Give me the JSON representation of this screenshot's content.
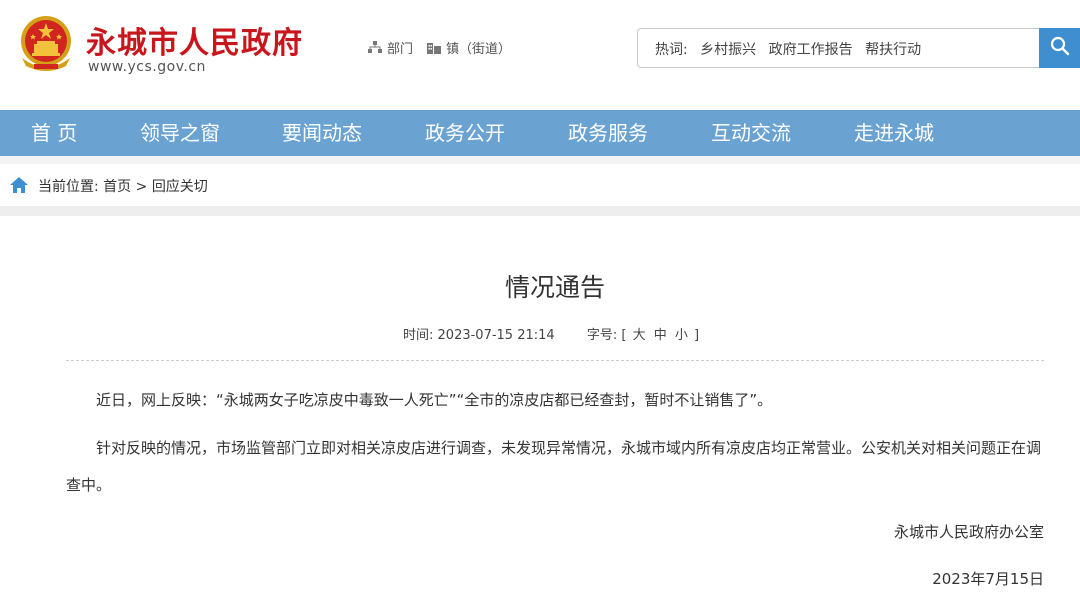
{
  "site": {
    "title": "永城市人民政府",
    "domain": "www.ycs.gov.cn"
  },
  "quick_links": [
    {
      "label": "部门",
      "icon": "org-chart-icon"
    },
    {
      "label": "镇（街道）",
      "icon": "building-icon"
    }
  ],
  "search": {
    "hot_label": "热词:",
    "hot_words": [
      "乡村振兴",
      "政府工作报告",
      "帮扶行动"
    ],
    "button_icon": "search-icon"
  },
  "nav": {
    "items": [
      "首 页",
      "领导之窗",
      "要闻动态",
      "政务公开",
      "政务服务",
      "互动交流",
      "走进永城"
    ]
  },
  "breadcrumb": {
    "prefix": "当前位置:",
    "home": "首页",
    "separator": ">",
    "current": "回应关切"
  },
  "article": {
    "title": "情况通告",
    "time_label": "时间:",
    "time_value": "2023-07-15 21:14",
    "size_label": "字号:",
    "size_open": "[",
    "size_large": "大",
    "size_medium": "中",
    "size_small": "小",
    "size_close": "]",
    "paragraphs": [
      "近日，网上反映：“永城两女子吃凉皮中毒致一人死亡”“全市的凉皮店都已经查封，暂时不让销售了”。",
      "针对反映的情况，市场监管部门立即对相关凉皮店进行调查，未发现异常情况，永城市域内所有凉皮店均正常营业。公安机关对相关问题正在调查中。"
    ],
    "signature": "永城市人民政府办公室",
    "date": "2023年7月15日"
  },
  "colors": {
    "brand_red": "#c8161d",
    "nav_blue": "#6aa3d2",
    "search_blue": "#3f8fd0"
  }
}
